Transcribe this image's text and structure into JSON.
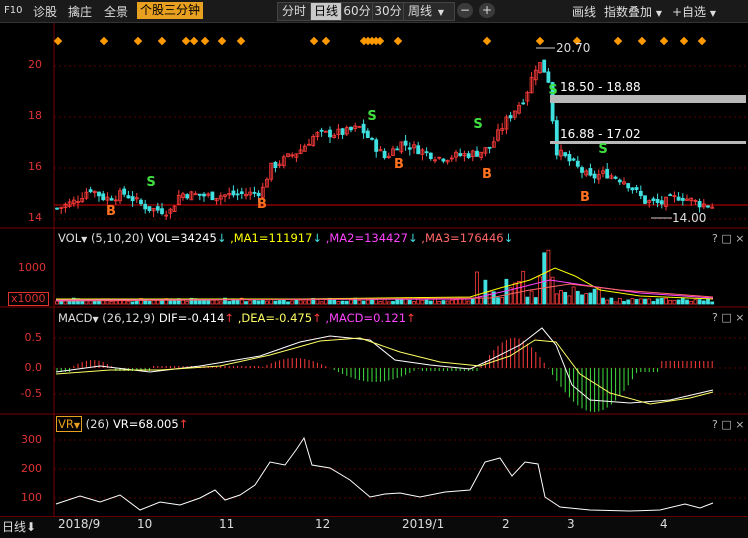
{
  "toolbar": {
    "f10": "F10",
    "diagnose": "诊股",
    "picks": "擒庄",
    "panorama": "全景",
    "active_tab": "个股三分钟",
    "periods": [
      "分时",
      "日线",
      "60分",
      "30分"
    ],
    "active_period": "日线",
    "week": "周线",
    "minus": "−",
    "plus": "+",
    "draw": "画线",
    "index_overlay": "指数叠加",
    "watchlist": "+自选"
  },
  "price_axis": {
    "ticks": [
      "20",
      "18",
      "16",
      "14"
    ]
  },
  "annotations": {
    "high": "20.70",
    "low": "14.00",
    "band1": "18.50 - 18.88",
    "band2": "16.88 - 17.02",
    "buy": "B",
    "sell": "S"
  },
  "vol_panel": {
    "name": "VOL",
    "params": "(5,10,20)",
    "vol": "VOL=34245",
    "ma1": ",MA1=111917",
    "ma2": ",MA2=134427",
    "ma3": ",MA3=176446",
    "axis": [
      "1000"
    ],
    "unit": "x1000"
  },
  "macd_panel": {
    "name": "MACD",
    "params": "(26,12,9)",
    "dif": "DIF=-0.414",
    "dea": ",DEA=-0.475",
    "macd": ",MACD=0.121",
    "axis": [
      "0.5",
      "0.0",
      "-0.5"
    ]
  },
  "vr_panel": {
    "name": "VR",
    "params": "(26)",
    "vr": "VR=68.005",
    "axis": [
      "300",
      "200",
      "100"
    ]
  },
  "panel_controls": {
    "help": "?",
    "restore": "□",
    "close": "×"
  },
  "bottom": {
    "period": "日线",
    "dates": [
      "2018/9",
      "10",
      "11",
      "12",
      "2019/1",
      "2",
      "3",
      "4"
    ]
  },
  "colors": {
    "up": "#ff3c3c",
    "down": "#40e0e0",
    "axis": "#d33",
    "ma1": "#ffff00",
    "ma2": "#ff44ff",
    "ma3": "#ff4444",
    "white": "#ffffff"
  }
}
